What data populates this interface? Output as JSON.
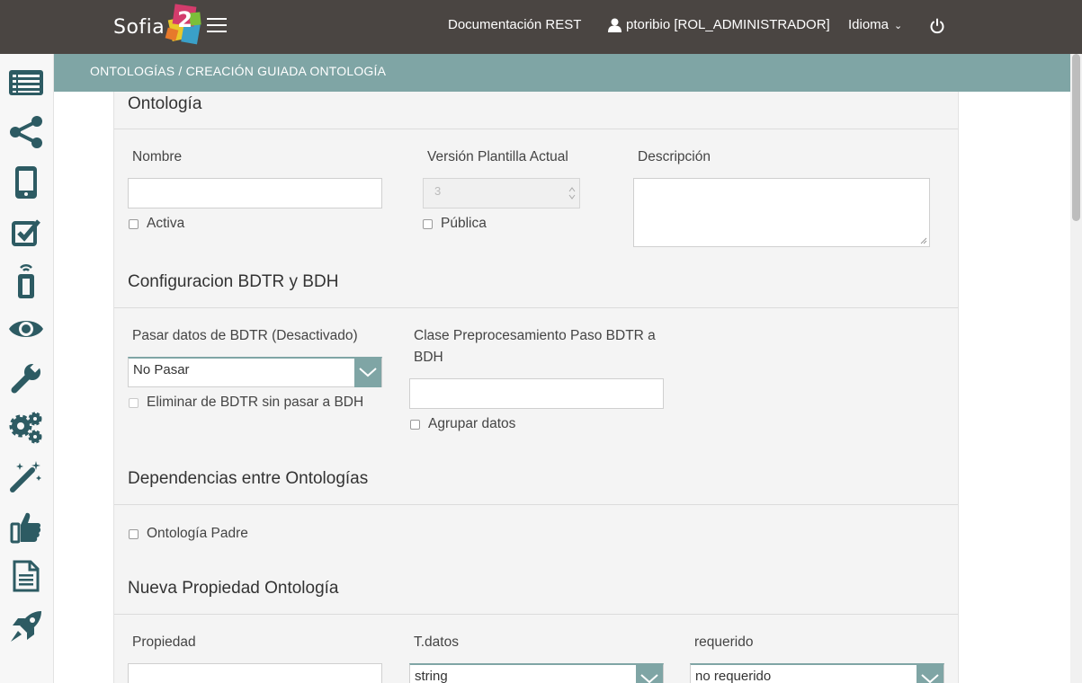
{
  "header": {
    "logo_text": "Sofia",
    "logo_number": "2",
    "doc_link": "Documentación REST",
    "user": "ptoribio [ROL_ADMINISTRADOR]",
    "language": "Idioma"
  },
  "breadcrumb": "ONTOLOGÍAS / CREACIÓN GUIADA ONTOLOGÍA",
  "sidebar": {
    "icons": [
      "list-icon",
      "share-icon",
      "mobile-icon",
      "checklist-icon",
      "remote-icon",
      "eye-icon",
      "wrench-icon",
      "gears-icon",
      "magic-wand-icon",
      "thumbs-up-icon",
      "document-icon",
      "rocket-icon"
    ]
  },
  "ontology": {
    "title": "Ontología",
    "name_label": "Nombre",
    "version_label": "Versión Plantilla Actual",
    "version_value": "3",
    "description_label": "Descripción",
    "active_label": "Activa",
    "public_label": "Pública"
  },
  "bdtr": {
    "title": "Configuracion BDTR y BDH",
    "pass_label": "Pasar datos de BDTR (Desactivado)",
    "pass_value": "No Pasar",
    "delete_label": "Eliminar de BDTR sin pasar a BDH",
    "class_label_line1": "Clase Preprocesamiento Paso BDTR a",
    "class_label_line2": "BDH",
    "group_label": "Agrupar datos"
  },
  "dependencies": {
    "title": "Dependencias entre Ontologías",
    "parent_label": "Ontología Padre"
  },
  "new_property": {
    "title": "Nueva Propiedad Ontología",
    "property_label": "Propiedad",
    "type_label": "T.datos",
    "type_value": "string",
    "required_label": "requerido",
    "required_value": "no requerido"
  },
  "colors": {
    "topbar": "#4a4542",
    "accent": "#7fa5a5",
    "icon": "#2d5b63"
  }
}
